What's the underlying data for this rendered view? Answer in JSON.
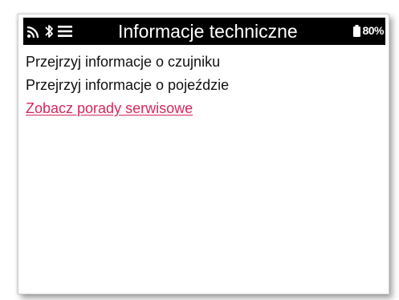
{
  "header": {
    "title": "Informacje techniczne",
    "battery": "80%",
    "icons": [
      "wireless-icon",
      "bluetooth-icon",
      "menu-icon",
      "battery-icon"
    ]
  },
  "menu": {
    "items": [
      {
        "label": "Przejrzyj informacje o czujniku"
      },
      {
        "label": "Przejrzyj informacje o pojeździe"
      },
      {
        "label": "Zobacz porady serwisowe"
      }
    ]
  },
  "colors": {
    "header_bg": "#000000",
    "header_text": "#ffffff",
    "link_accent": "#d6285d",
    "text": "#111111"
  }
}
